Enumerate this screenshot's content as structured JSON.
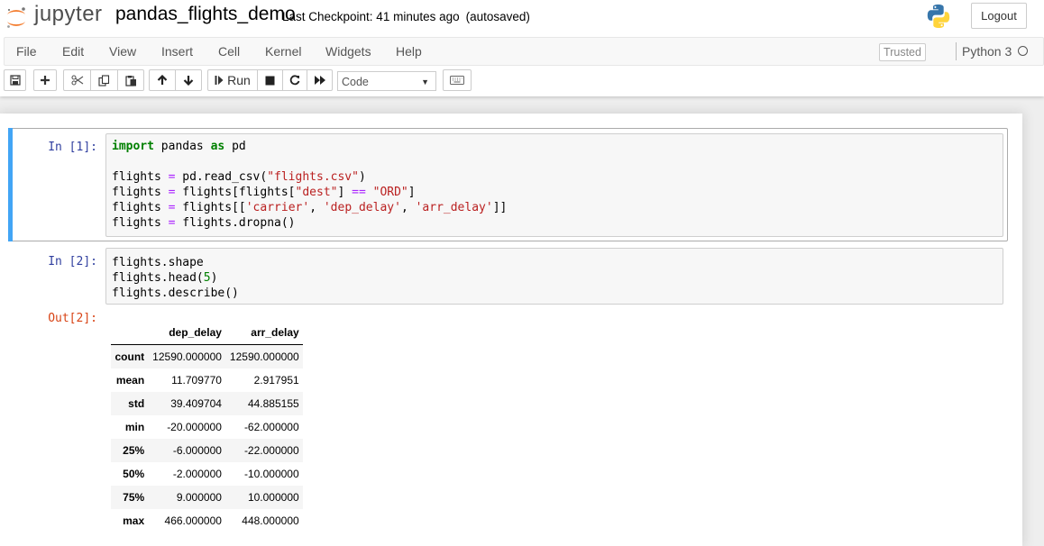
{
  "app": {
    "logo_text": "jupyter",
    "notebook_name": "pandas_flights_demo",
    "checkpoint": "Last Checkpoint: 41 minutes ago",
    "autosave_status": "(autosaved)",
    "logout_label": "Logout"
  },
  "menu": {
    "items": [
      "File",
      "Edit",
      "View",
      "Insert",
      "Cell",
      "Kernel",
      "Widgets",
      "Help"
    ],
    "trusted_label": "Trusted",
    "kernel_name": "Python 3"
  },
  "toolbar": {
    "buttons": [
      "save-icon",
      "plus-icon",
      "cut-icon",
      "copy-icon",
      "paste-icon",
      "arrow-up-icon",
      "arrow-down-icon",
      "run-icon",
      "stop-icon",
      "restart-icon",
      "fast-forward-icon",
      "keyboard-icon"
    ],
    "run_label": "Run",
    "cell_type_value": "Code"
  },
  "cells": [
    {
      "prompt": "In [1]:",
      "lines": [
        "import pandas as pd",
        "",
        "flights = pd.read_csv(\"flights.csv\")",
        "flights = flights[flights[\"dest\"] == \"ORD\"]",
        "flights = flights[['carrier', 'dep_delay', 'arr_delay']]",
        "flights = flights.dropna()"
      ]
    },
    {
      "prompt": "In [2]:",
      "lines": [
        "flights.shape",
        "flights.head(5)",
        "flights.describe()"
      ],
      "out_prompt": "Out[2]:"
    }
  ],
  "output_table": {
    "columns": [
      "dep_delay",
      "arr_delay"
    ],
    "rows": [
      {
        "label": "count",
        "values": [
          "12590.000000",
          "12590.000000"
        ]
      },
      {
        "label": "mean",
        "values": [
          "11.709770",
          "2.917951"
        ]
      },
      {
        "label": "std",
        "values": [
          "39.409704",
          "44.885155"
        ]
      },
      {
        "label": "min",
        "values": [
          "-20.000000",
          "-62.000000"
        ]
      },
      {
        "label": "25%",
        "values": [
          "-6.000000",
          "-22.000000"
        ]
      },
      {
        "label": "50%",
        "values": [
          "-2.000000",
          "-10.000000"
        ]
      },
      {
        "label": "75%",
        "values": [
          "9.000000",
          "10.000000"
        ]
      },
      {
        "label": "max",
        "values": [
          "466.000000",
          "448.000000"
        ]
      }
    ]
  },
  "colors": {
    "selected_cell_bar": "#42a5f5",
    "in_prompt": "#303f9f",
    "out_prompt": "#d84315",
    "keyword": "#008000",
    "string": "#ba2121",
    "operator": "#aa22ff"
  }
}
